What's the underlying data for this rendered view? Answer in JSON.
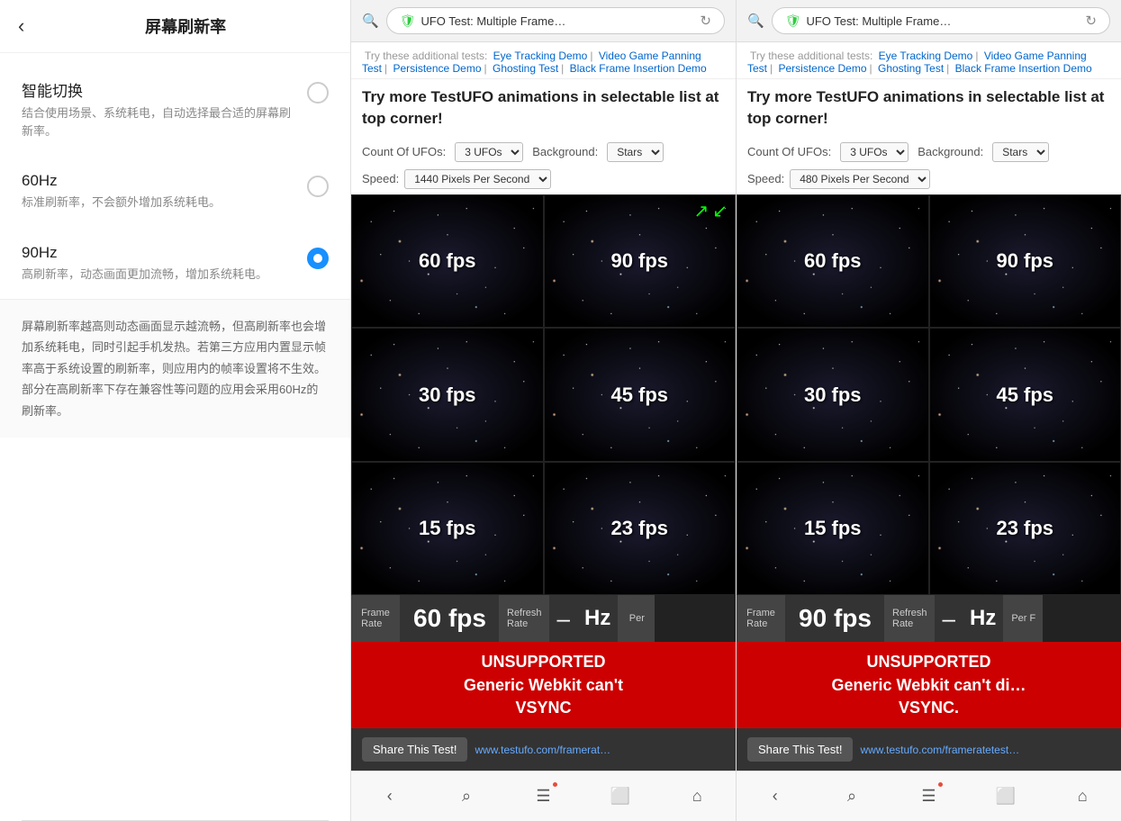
{
  "left": {
    "title": "屏幕刷新率",
    "back_label": "‹",
    "options": [
      {
        "label": "智能切换",
        "desc": "结合使用场景、系统耗电，自动选择最合适的屏幕刷新率。",
        "active": false
      },
      {
        "label": "60Hz",
        "desc": "标准刷新率，不会额外增加系统耗电。",
        "active": false
      },
      {
        "label": "90Hz",
        "desc": "高刷新率，动态画面更加流畅，增加系统耗电。",
        "active": true
      }
    ],
    "description": "屏幕刷新率越高则动态画面显示越流畅，但高刷新率也会增加系统耗电，同时引起手机发热。若第三方应用内置显示帧率高于系统设置的刷新率，则应用内的帧率设置将不生效。部分在高刷新率下存在兼容性等问题的应用会采用60Hz的刷新率。"
  },
  "browsers": [
    {
      "address": "UFO Test: Multiple Frame…",
      "intro_text": "Try these additional tests:",
      "links": [
        "Eye Tracking Demo",
        "Video Game Panning Test",
        "Persistence Demo",
        "Ghosting Test",
        "Black Frame Insertion Demo"
      ],
      "promo": "Try more TestUFO animations in selectable list at top corner!",
      "count_label": "Count Of UFOs:",
      "count_value": "3 UFOs",
      "bg_label": "Background:",
      "bg_value": "Stars",
      "speed_label": "Speed:",
      "speed_value": "1440 Pixels Per Second",
      "cells": [
        {
          "fps": "60 fps"
        },
        {
          "fps": "90 fps"
        },
        {
          "fps": "30 fps"
        },
        {
          "fps": "45 fps"
        },
        {
          "fps": "15 fps"
        },
        {
          "fps": "23 fps"
        }
      ],
      "stats": {
        "frame_rate_label": "Frame\nRate",
        "fps_val": "60 fps",
        "refresh_rate_label": "Refresh\nRate",
        "dash": "–",
        "hz": "Hz",
        "per_label": "Per"
      },
      "unsupported": "UNSUPPORTED\nGeneric Webkit can't\nVSYNC",
      "share_btn": "Share This Test!",
      "share_url": "www.testufo.com/framerat…"
    },
    {
      "address": "UFO Test: Multiple Frame…",
      "intro_text": "Try these additional tests:",
      "links": [
        "Eye Tracking Demo",
        "Video Game Panning Test",
        "Persistence Demo",
        "Ghosting Test",
        "Black Frame Insertion Demo"
      ],
      "promo": "Try more TestUFO animations in selectable list at top corner!",
      "count_label": "Count Of UFOs:",
      "count_value": "3 UFOs",
      "bg_label": "Background:",
      "bg_value": "Stars",
      "speed_label": "Speed:",
      "speed_value": "480 Pixels Per Second",
      "cells": [
        {
          "fps": "60 fps"
        },
        {
          "fps": "90 fps"
        },
        {
          "fps": "30 fps"
        },
        {
          "fps": "45 fps"
        },
        {
          "fps": "15 fps"
        },
        {
          "fps": "23 fps"
        }
      ],
      "stats": {
        "frame_rate_label": "Frame\nRate",
        "fps_val": "90 fps",
        "refresh_rate_label": "Refresh\nRate",
        "dash": "–",
        "hz": "Hz",
        "per_label": "Per"
      },
      "unsupported": "UNSUPPORTED\nGeneric Webkit can't di…\nVSYNC.",
      "share_btn": "Share This Test!",
      "share_url": "www.testufo.com/frameratetest…"
    }
  ],
  "nav": {
    "back": "‹",
    "search": "◯",
    "menu": "☰",
    "tab": "⬜",
    "home": "⌂"
  }
}
